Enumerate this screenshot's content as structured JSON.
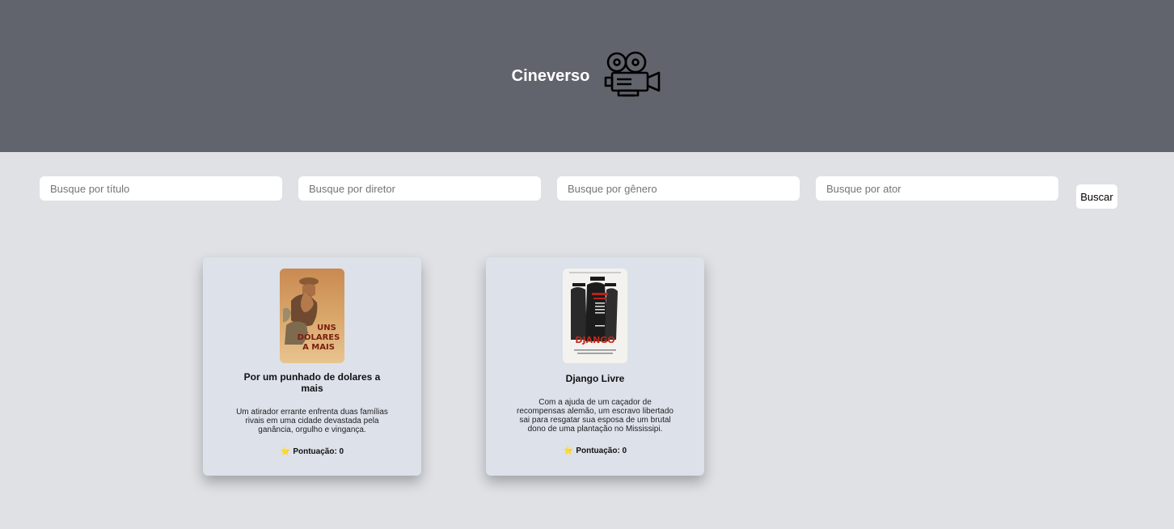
{
  "header": {
    "title": "Cineverso",
    "logo_icon": "movie-camera-icon"
  },
  "search": {
    "title_placeholder": "Busque por título",
    "director_placeholder": "Busque por diretor",
    "genre_placeholder": "Busque por gênero",
    "actor_placeholder": "Busque por ator",
    "button_label": "Buscar"
  },
  "movies": [
    {
      "title": "Por um punhado de dolares a mais",
      "description": "Um atirador errante enfrenta duas famílias rivais em uma cidade devastada pela ganância, orgulho e vingança.",
      "score_label": "Pontuação: 0",
      "score_icon": "star-icon",
      "poster_text": "UNS DÓLARES A MAIS"
    },
    {
      "title": "Django Livre",
      "description": "Com a ajuda de um caçador de recompensas alemão, um escravo libertado sai para resgatar sua esposa de um brutal dono de uma plantação no Mississipi.",
      "score_label": "Pontuação: 0",
      "score_icon": "star-icon",
      "poster_text": "DJANGO"
    }
  ],
  "colors": {
    "header_bg": "#61646c",
    "page_bg": "#dfe1e5",
    "card_bg": "#dde1ea"
  }
}
